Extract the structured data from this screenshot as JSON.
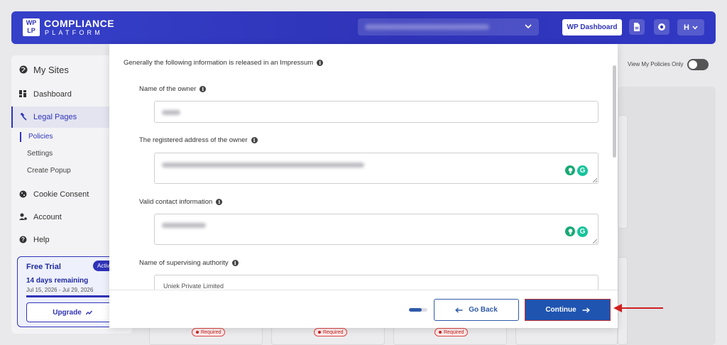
{
  "header": {
    "logo_box": "WP\nLP",
    "logo_title": "COMPLIANCE",
    "logo_subtitle": "PLATFORM",
    "wp_dashboard_label": "WP Dashboard",
    "avatar_letter": "H"
  },
  "sidebar": {
    "my_sites": "My Sites",
    "items": [
      {
        "label": "Dashboard"
      },
      {
        "label": "Legal Pages"
      },
      {
        "label": "Cookie Consent"
      },
      {
        "label": "Account"
      },
      {
        "label": "Help"
      }
    ],
    "sub_items": [
      {
        "label": "Policies"
      },
      {
        "label": "Settings"
      },
      {
        "label": "Create Popup"
      }
    ],
    "trial": {
      "title": "Free Trial",
      "badge": "Active",
      "days": "14 days remaining",
      "dates": "Jul 15, 2026 - Jul 29, 2026",
      "upgrade_label": "Upgrade"
    }
  },
  "background": {
    "toggle_label": "View My Policies Only",
    "required_label": "Required"
  },
  "modal": {
    "intro": "Generally the following information is released in an Impressum",
    "fields": [
      {
        "label": "Name of the owner"
      },
      {
        "label": "The registered address of the owner"
      },
      {
        "label": "Valid contact information"
      },
      {
        "label": "Name of supervising authority",
        "partial_value": "Uniek Private Limited"
      }
    ],
    "go_back_label": "Go Back",
    "continue_label": "Continue",
    "progress_fraction": 0.7
  },
  "colors": {
    "brand": "#2f33b8",
    "button_blue": "#1f54b0",
    "pointer_red": "#d21f1f"
  }
}
